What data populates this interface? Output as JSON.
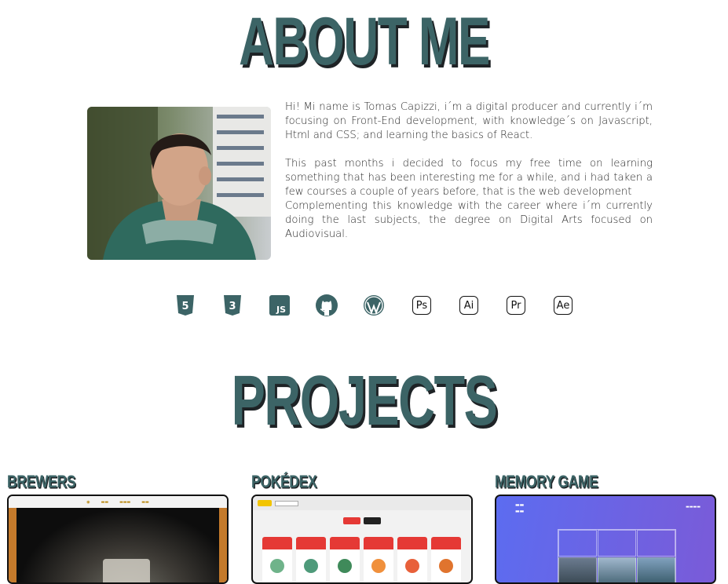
{
  "about": {
    "title": "ABOUT ME",
    "bio": [
      "Hi! Mi name is Tomas Capizzi, i´m a digital producer and currently i´m focusing on Front-End development, with knowledge´s on Javascript, Html and CSS; and learning the basics of React.",
      "This past months i decided to focus my free time on learning something that has been interesting me for a while, and i had taken a few courses a couple of years before, that is the web development",
      "Complementing this knowledge with the career where i´m currently doing the last subjects, the degree on Digital Arts focused on Audiovisual."
    ]
  },
  "skills": [
    {
      "icon": "html5-icon",
      "text": "5"
    },
    {
      "icon": "css3-icon",
      "text": "3"
    },
    {
      "icon": "javascript-icon",
      "text": "JS"
    },
    {
      "icon": "github-icon",
      "text": ""
    },
    {
      "icon": "wordpress-icon",
      "text": ""
    },
    {
      "icon": "photoshop-icon",
      "text": "Ps"
    },
    {
      "icon": "illustrator-icon",
      "text": "Ai"
    },
    {
      "icon": "premiere-icon",
      "text": "Pr"
    },
    {
      "icon": "after-effects-icon",
      "text": "Ae"
    }
  ],
  "colors": {
    "accent": "#3c6466",
    "shadow": "#1e2326"
  },
  "projects": {
    "title": "PROJECTS",
    "items": [
      {
        "name": "BREWERS"
      },
      {
        "name": "POKÉDEX"
      },
      {
        "name": "MEMORY GAME"
      }
    ]
  }
}
